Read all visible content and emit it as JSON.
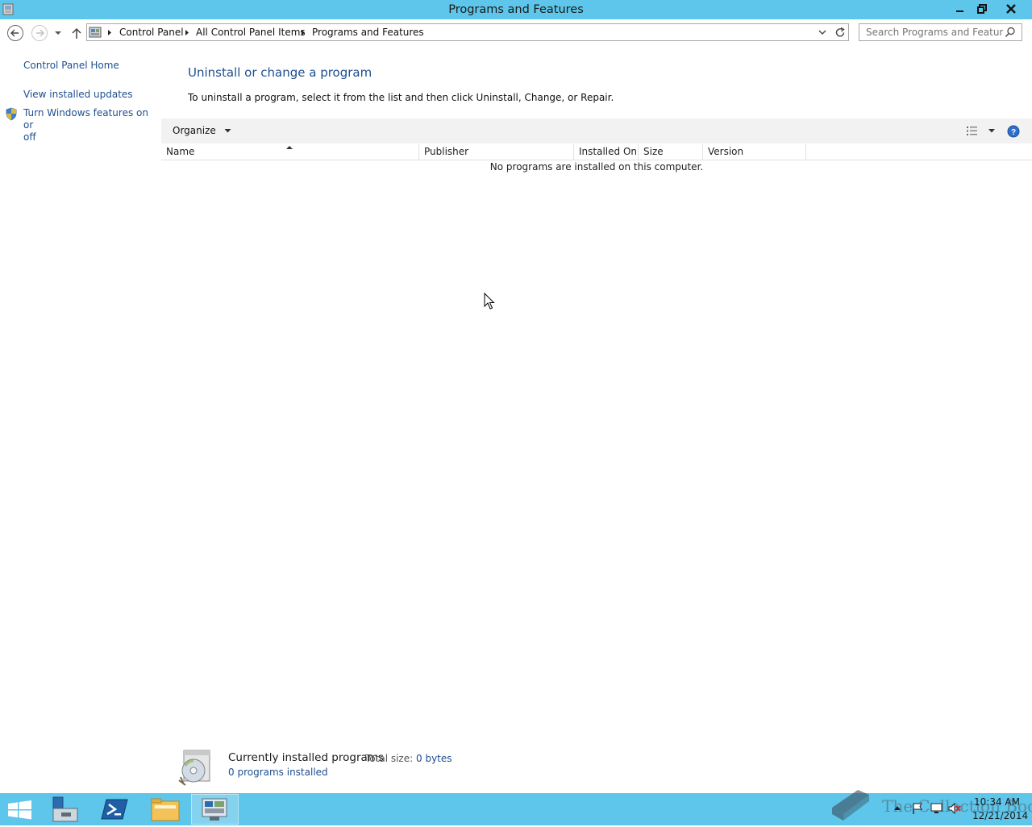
{
  "window": {
    "title": "Programs and Features",
    "buttons": {
      "minimize": "▁",
      "restore": "❐",
      "close": "✕"
    }
  },
  "address": {
    "crumbs": [
      "Control Panel",
      "All Control Panel Items",
      "Programs and Features"
    ]
  },
  "search": {
    "placeholder": "Search Programs and Features"
  },
  "sidebar": {
    "home": "Control Panel Home",
    "updates": "View installed updates",
    "features_line1": "Turn Windows features on or",
    "features_line2": "off"
  },
  "main": {
    "heading": "Uninstall or change a program",
    "instructions": "To uninstall a program, select it from the list and then click Uninstall, Change, or Repair.",
    "toolbar": {
      "organize": "Organize"
    },
    "columns": [
      "Name",
      "Publisher",
      "Installed On",
      "Size",
      "Version"
    ],
    "empty_message": "No programs are installed on this computer."
  },
  "details": {
    "title": "Currently installed programs",
    "size_label": "Total size:",
    "size_value": "0 bytes",
    "count": "0 programs installed"
  },
  "taskbar": {
    "time": "10:34 AM",
    "date": "12/21/2014",
    "watermark": "The Collection Book"
  },
  "colors": {
    "titlebar": "#5dc6ea",
    "link": "#1e4f8f",
    "toolbar": "#f2f2f2"
  }
}
